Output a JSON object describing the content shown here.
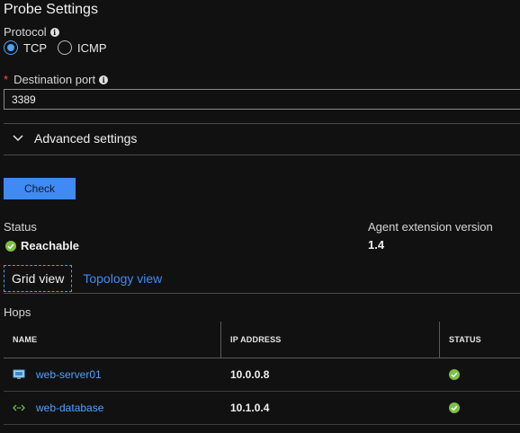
{
  "panel": {
    "title": "Probe Settings"
  },
  "protocol": {
    "label": "Protocol",
    "options": [
      {
        "label": "TCP",
        "selected": true
      },
      {
        "label": "ICMP",
        "selected": false
      }
    ]
  },
  "destination_port": {
    "required_marker": "*",
    "label": "Destination port",
    "value": "3389"
  },
  "advanced": {
    "label": "Advanced settings",
    "expanded": false
  },
  "check_button": {
    "label": "Check"
  },
  "status": {
    "label": "Status",
    "value": "Reachable",
    "icon": "green-check-icon"
  },
  "agent_extension": {
    "label": "Agent extension version",
    "value": "1.4"
  },
  "tabs": [
    {
      "label": "Grid view",
      "active": true
    },
    {
      "label": "Topology view",
      "active": false
    }
  ],
  "hops": {
    "label": "Hops",
    "columns": [
      "NAME",
      "IP ADDRESS",
      "STATUS"
    ],
    "rows": [
      {
        "name": "web-server01",
        "icon": "virtual-machine-icon",
        "ip": "10.0.0.8",
        "status_icon": "green-check-icon"
      },
      {
        "name": "web-database",
        "icon": "network-interface-icon",
        "ip": "10.1.0.4",
        "status_icon": "green-check-icon"
      }
    ]
  },
  "colors": {
    "background": "#111111",
    "accent": "#3f8bf3",
    "link": "#4ea1ff",
    "success": "#7bc043",
    "required": "#ff4b4b"
  }
}
